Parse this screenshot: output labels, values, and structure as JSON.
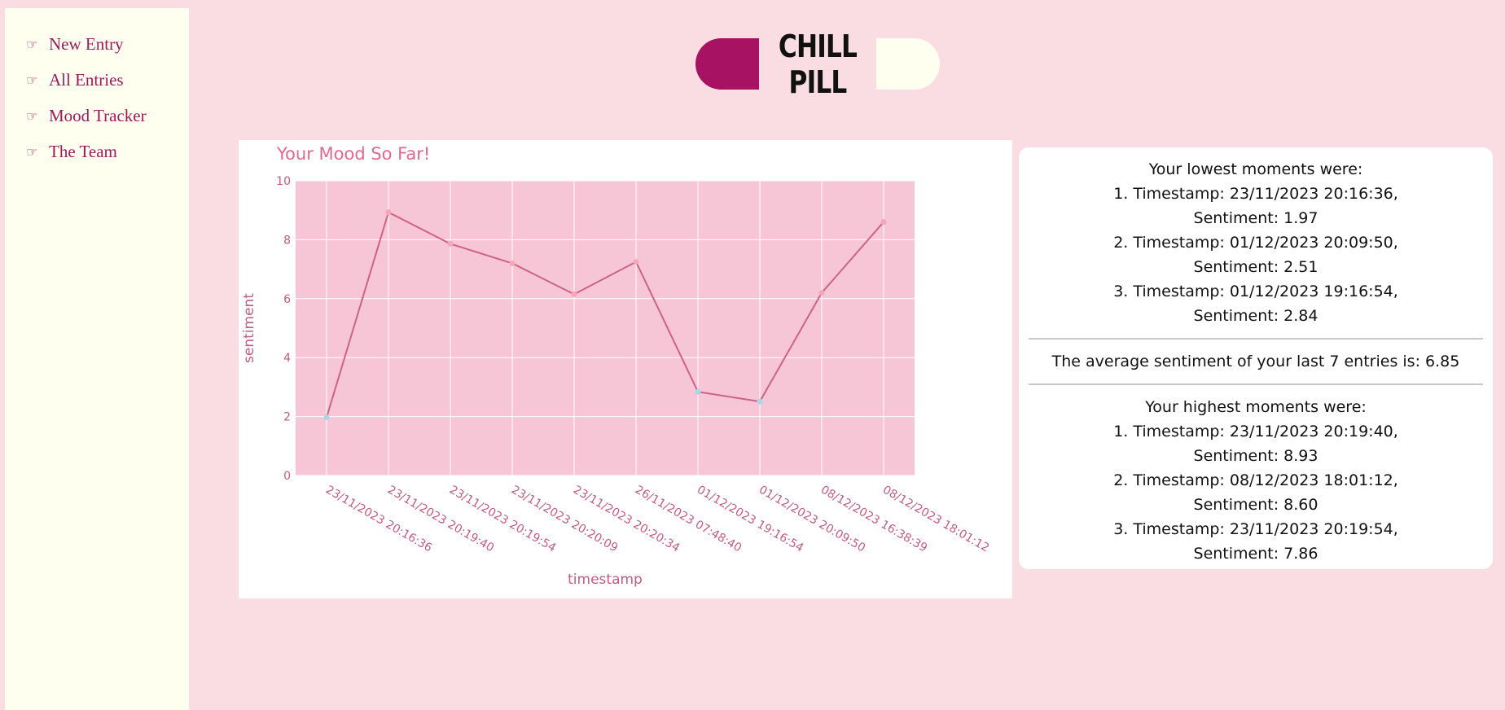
{
  "sidebar": {
    "items": [
      {
        "icon": "pointing-hand-icon",
        "glyph": "☞",
        "label": "New Entry"
      },
      {
        "icon": "pointing-hand-icon",
        "glyph": "☞",
        "label": "All Entries"
      },
      {
        "icon": "pointing-hand-icon",
        "glyph": "☞",
        "label": "Mood Tracker"
      },
      {
        "icon": "pointing-hand-icon",
        "glyph": "☞",
        "label": "The Team"
      }
    ]
  },
  "header": {
    "logo_text": "CHILL PILL"
  },
  "colors": {
    "background": "#fadde3",
    "sidebar": "#fffff0",
    "brand": "#a71262",
    "plot_bg": "#f7c6d6",
    "line": "#cc6385",
    "marker_high": "#f4a7b6",
    "marker_low": "#a8d8e8"
  },
  "chart_data": {
    "type": "line",
    "title": "Your Mood So Far!",
    "xlabel": "timestamp",
    "ylabel": "sentiment",
    "ylim": [
      0,
      10
    ],
    "yticks": [
      0,
      2,
      4,
      6,
      8,
      10
    ],
    "grid": true,
    "categories": [
      "23/11/2023 20:16:36",
      "23/11/2023 20:19:40",
      "23/11/2023 20:19:54",
      "23/11/2023 20:20:09",
      "23/11/2023 20:20:34",
      "26/11/2023 07:48:40",
      "01/12/2023 19:16:54",
      "01/12/2023 20:09:50",
      "08/12/2023 16:38:39",
      "08/12/2023 18:01:12"
    ],
    "values": [
      1.97,
      8.93,
      7.86,
      7.2,
      6.15,
      7.25,
      2.84,
      2.51,
      6.2,
      8.6
    ]
  },
  "stats": {
    "lowest_title": "Your lowest moments were:",
    "lowest": [
      {
        "timestamp": "1. Timestamp: 23/11/2023 20:16:36,",
        "sentiment": "Sentiment: 1.97"
      },
      {
        "timestamp": "2. Timestamp: 01/12/2023 20:09:50,",
        "sentiment": "Sentiment: 2.51"
      },
      {
        "timestamp": "3. Timestamp: 01/12/2023 19:16:54,",
        "sentiment": "Sentiment: 2.84"
      }
    ],
    "average": "The average sentiment of your last 7 entries is: 6.85",
    "highest_title": "Your highest moments were:",
    "highest": [
      {
        "timestamp": "1. Timestamp: 23/11/2023 20:19:40,",
        "sentiment": "Sentiment: 8.93"
      },
      {
        "timestamp": "2. Timestamp: 08/12/2023 18:01:12,",
        "sentiment": "Sentiment: 8.60"
      },
      {
        "timestamp": "3. Timestamp: 23/11/2023 20:19:54,",
        "sentiment": "Sentiment: 7.86"
      }
    ]
  }
}
